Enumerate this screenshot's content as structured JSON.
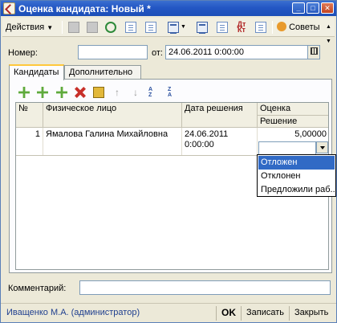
{
  "window": {
    "title": "Оценка кандидата: Новый *"
  },
  "toolbar": {
    "actions_label": "Действия",
    "tips_label": "Советы"
  },
  "form": {
    "number_label": "Номер:",
    "number_value": "",
    "from_label": "от:",
    "date_value": "24.06.2011  0:00:00"
  },
  "tabs": [
    {
      "label": "Кандидаты"
    },
    {
      "label": "Дополнительно"
    }
  ],
  "table": {
    "headers": {
      "num": "№",
      "person": "Физическое лицо",
      "decision_date": "Дата решения",
      "rating": "Оценка",
      "decision": "Решение"
    },
    "rows": [
      {
        "num": "1",
        "person": "Ямалова Галина Михайловна",
        "decision_date_line1": "24.06.2011",
        "decision_date_line2": "0:00:00",
        "rating": "5,00000",
        "decision": ""
      }
    ]
  },
  "dropdown": {
    "options": [
      "Отложен",
      "Отклонен",
      "Предложили раб..."
    ],
    "selected_index": 0
  },
  "comment": {
    "label": "Комментарий:",
    "value": ""
  },
  "statusbar": {
    "user": "Иващенко М.А. (администратор)",
    "ok_label": "OK",
    "write_label": "Записать",
    "close_label": "Закрыть"
  },
  "colors": {
    "titlebar": "#2457c4",
    "selection": "#316ac5",
    "active_tab_marker": "#ffc83c",
    "user_link": "#1f3f8f"
  }
}
